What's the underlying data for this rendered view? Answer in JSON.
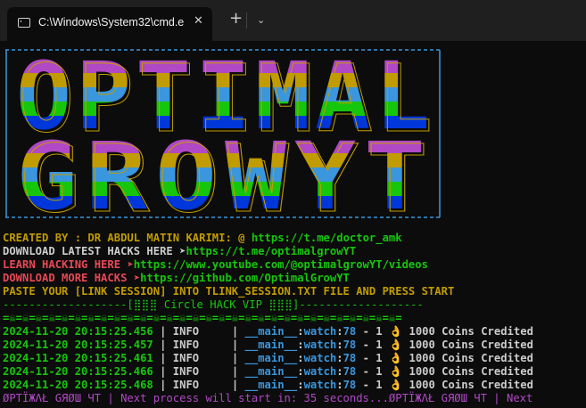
{
  "window": {
    "tab_title": "C:\\Windows\\System32\\cmd.e",
    "close_glyph": "✕",
    "new_tab_glyph": "+",
    "dropdown_glyph": "⌄"
  },
  "banner": {
    "text_lines": [
      "OPTIMAL",
      "GROWYT"
    ],
    "colors": [
      "#b148c6",
      "#c19c00",
      "#3a96dd",
      "#16c60c",
      "#0037da"
    ],
    "border_color": "#3a96dd"
  },
  "credits": {
    "created_prefix": "CREATED BY : DR ABDUL MATIN KARIMI: ",
    "created_link": "https://t.me/doctor_amk",
    "download_prefix": "DOWNLOAD LATEST HACKS HERE ➤",
    "download_link": "https://t.me/optimalgrowYT",
    "learn_prefix": "LEARN HACKING HERE ➤",
    "learn_link": "https://www.youtube.com/@optimalgrowYT/videos",
    "more_prefix": "DOWNLOAD MORE HACKS ➤",
    "more_link": "https://github.com/OptimalGrowYT",
    "paste_line": "PASTE YOUR [LINK SESSION] INTO TLINK_SESSION.TXT FILE AND PRESS START"
  },
  "header_rule": "-------------------[⣿⣿⣿ Circle HACK VIP ⣿⣿⣿]-------------------",
  "skull_rule": "=☠=☠=☠=☠=☠=☠=☠=☠=☠=☠=☠=☠=☠=☠=☠=☠=☠=☠=☠=☠=☠=☠=☠=☠=☠=☠=☠=☠=☠=☠=",
  "log_rows": [
    {
      "time": "2024-11-20 20:15:25.456",
      "level": "INFO",
      "module": "__main__",
      "func": "watch",
      "line": "78",
      "num": "1",
      "msg": "1000 Coins Credited"
    },
    {
      "time": "2024-11-20 20:15:25.457",
      "level": "INFO",
      "module": "__main__",
      "func": "watch",
      "line": "78",
      "num": "1",
      "msg": "1000 Coins Credited"
    },
    {
      "time": "2024-11-20 20:15:25.461",
      "level": "INFO",
      "module": "__main__",
      "func": "watch",
      "line": "78",
      "num": "1",
      "msg": "1000 Coins Credited"
    },
    {
      "time": "2024-11-20 20:15:25.466",
      "level": "INFO",
      "module": "__main__",
      "func": "watch",
      "line": "78",
      "num": "1",
      "msg": "1000 Coins Credited"
    },
    {
      "time": "2024-11-20 20:15:25.468",
      "level": "INFO",
      "module": "__main__",
      "func": "watch",
      "line": "78",
      "num": "1",
      "msg": "1000 Coins Credited"
    }
  ],
  "status_line": "ØPTÏЖΛŁ GЯØШ ЧT | Next process will start in: 35 seconds...ØPTÏЖΛŁ GЯØШ ЧT | Next"
}
